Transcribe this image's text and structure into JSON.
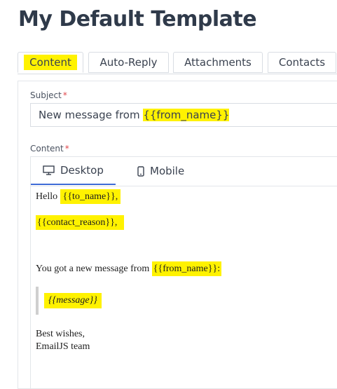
{
  "page": {
    "title": "My Default Template"
  },
  "tabs": [
    {
      "label": "Content",
      "active": true
    },
    {
      "label": "Auto-Reply",
      "active": false
    },
    {
      "label": "Attachments",
      "active": false
    },
    {
      "label": "Contacts",
      "active": false
    }
  ],
  "subject": {
    "label": "Subject",
    "required_mark": "*",
    "value_prefix": "New message from ",
    "value_var": "{{from_name}}"
  },
  "content": {
    "label": "Content",
    "required_mark": "*",
    "editor_tabs": [
      {
        "label": "Desktop",
        "icon": "desktop-icon",
        "active": true
      },
      {
        "label": "Mobile",
        "icon": "mobile-icon",
        "active": false
      }
    ],
    "body": {
      "hello": "Hello ",
      "to_name": "{{to_name}},",
      "contact_reason": "{{contact_reason}},",
      "message_prefix": "You got a new message from ",
      "from_name": "{{from_name}}:",
      "message_var": "{{message}}",
      "signoff": "Best wishes,",
      "team": "EmailJS team"
    }
  },
  "colors": {
    "highlight": "#fff200",
    "accent": "#3e6bd6",
    "required": "#e0474c"
  }
}
